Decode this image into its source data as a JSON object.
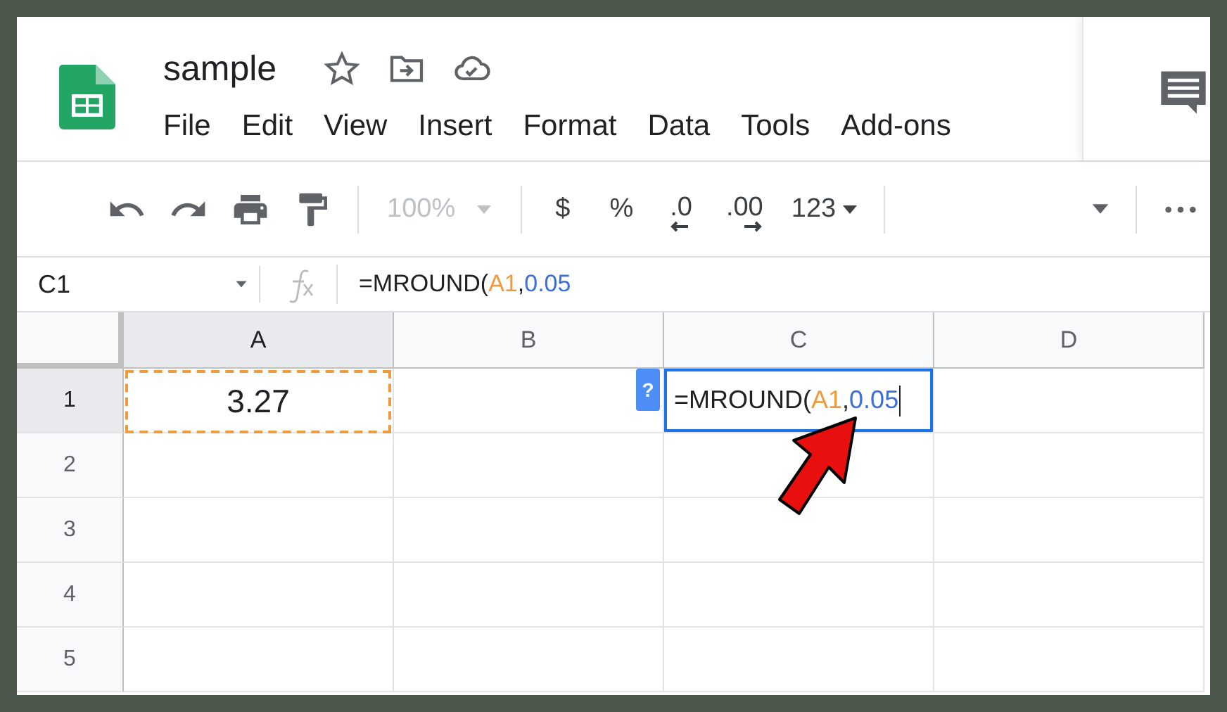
{
  "document": {
    "title": "sample"
  },
  "menu": [
    "File",
    "Edit",
    "View",
    "Insert",
    "Format",
    "Data",
    "Tools",
    "Add-ons"
  ],
  "toolbar": {
    "zoom": "100%",
    "currency": "$",
    "percent": "%",
    "decrease_decimals": ".0",
    "increase_decimals": ".00",
    "number_format": "123"
  },
  "formula_bar": {
    "name_box": "C1",
    "formula": [
      {
        "text": "=MROUND(",
        "kind": "plain"
      },
      {
        "text": "A1",
        "kind": "ref"
      },
      {
        "text": ",",
        "kind": "plain"
      },
      {
        "text": "0.05",
        "kind": "number"
      }
    ]
  },
  "columns": [
    {
      "label": "A",
      "selected": true
    },
    {
      "label": "B",
      "selected": false
    },
    {
      "label": "C",
      "selected": false
    },
    {
      "label": "D",
      "selected": false
    }
  ],
  "rows": [
    {
      "label": "1",
      "selected": true,
      "cells": [
        {
          "copied": true,
          "value": "3.27"
        },
        {},
        {
          "editing": true,
          "hint": "?",
          "formula": [
            {
              "text": "=MROUND(",
              "kind": "plain"
            },
            {
              "text": "A1",
              "kind": "ref"
            },
            {
              "text": ",",
              "kind": "plain"
            },
            {
              "text": "0.05",
              "kind": "number"
            }
          ]
        },
        {}
      ]
    },
    {
      "label": "2",
      "selected": false,
      "cells": []
    },
    {
      "label": "3",
      "selected": false,
      "cells": []
    },
    {
      "label": "4",
      "selected": false,
      "cells": []
    },
    {
      "label": "5",
      "selected": false,
      "cells": []
    }
  ]
}
